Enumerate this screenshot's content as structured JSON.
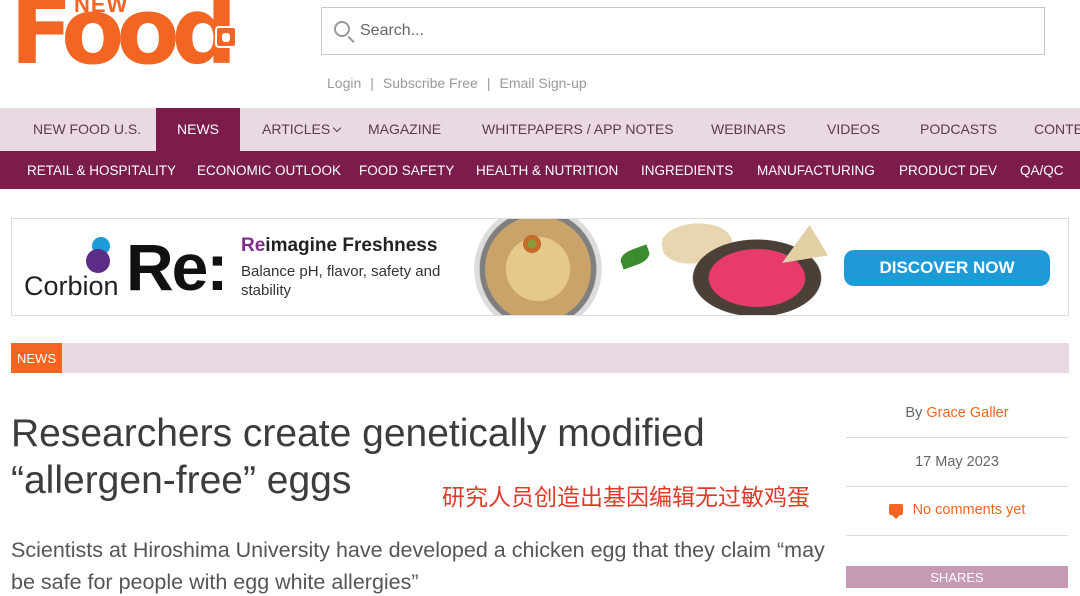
{
  "brand": {
    "logo_top": "NEW",
    "logo_main": "Food"
  },
  "search": {
    "placeholder": "Search..."
  },
  "account_links": {
    "login": "Login",
    "subscribe": "Subscribe Free",
    "email": "Email Sign-up",
    "separator": "|"
  },
  "nav_primary": [
    {
      "label": "NEW FOOD U.S."
    },
    {
      "label": "NEWS",
      "active": true
    },
    {
      "label": "ARTICLES",
      "has_dropdown": true
    },
    {
      "label": "MAGAZINE"
    },
    {
      "label": "WHITEPAPERS / APP NOTES"
    },
    {
      "label": "WEBINARS"
    },
    {
      "label": "VIDEOS"
    },
    {
      "label": "PODCASTS"
    },
    {
      "label": "CONTE"
    }
  ],
  "nav_secondary": [
    {
      "label": "RETAIL & HOSPITALITY"
    },
    {
      "label": "ECONOMIC OUTLOOK"
    },
    {
      "label": "FOOD SAFETY"
    },
    {
      "label": "HEALTH & NUTRITION"
    },
    {
      "label": "INGREDIENTS"
    },
    {
      "label": "MANUFACTURING"
    },
    {
      "label": "PRODUCT DEV"
    },
    {
      "label": "QA/QC"
    }
  ],
  "banner": {
    "advertiser": "Corbion",
    "re_mark": "Re:",
    "headline_highlight": "Re",
    "headline_rest": "imagine Freshness",
    "subline": "Balance pH, flavor, safety and stability",
    "cta": "DISCOVER NOW"
  },
  "category": {
    "label": "NEWS"
  },
  "article": {
    "title_line1": "Researchers create genetically modified",
    "title_line2": "“allergen-free” eggs",
    "overlay_caption": "研究人员创造出基因编辑无过敏鸡蛋",
    "standfirst": "Scientists at Hiroshima University have developed a chicken egg that they claim “may be safe for people with egg white allergies”"
  },
  "sidebar": {
    "by_prefix": "By",
    "author": "Grace Galler",
    "date": "17 May 2023",
    "comments": "No comments yet",
    "shares_label": "SHARES"
  },
  "colors": {
    "brand_orange": "#f26522",
    "nav_plum": "#7b1c4b",
    "nav_light": "#ead9e2",
    "cta_blue": "#1e9bd6",
    "overlay_red": "#e23a2a"
  }
}
